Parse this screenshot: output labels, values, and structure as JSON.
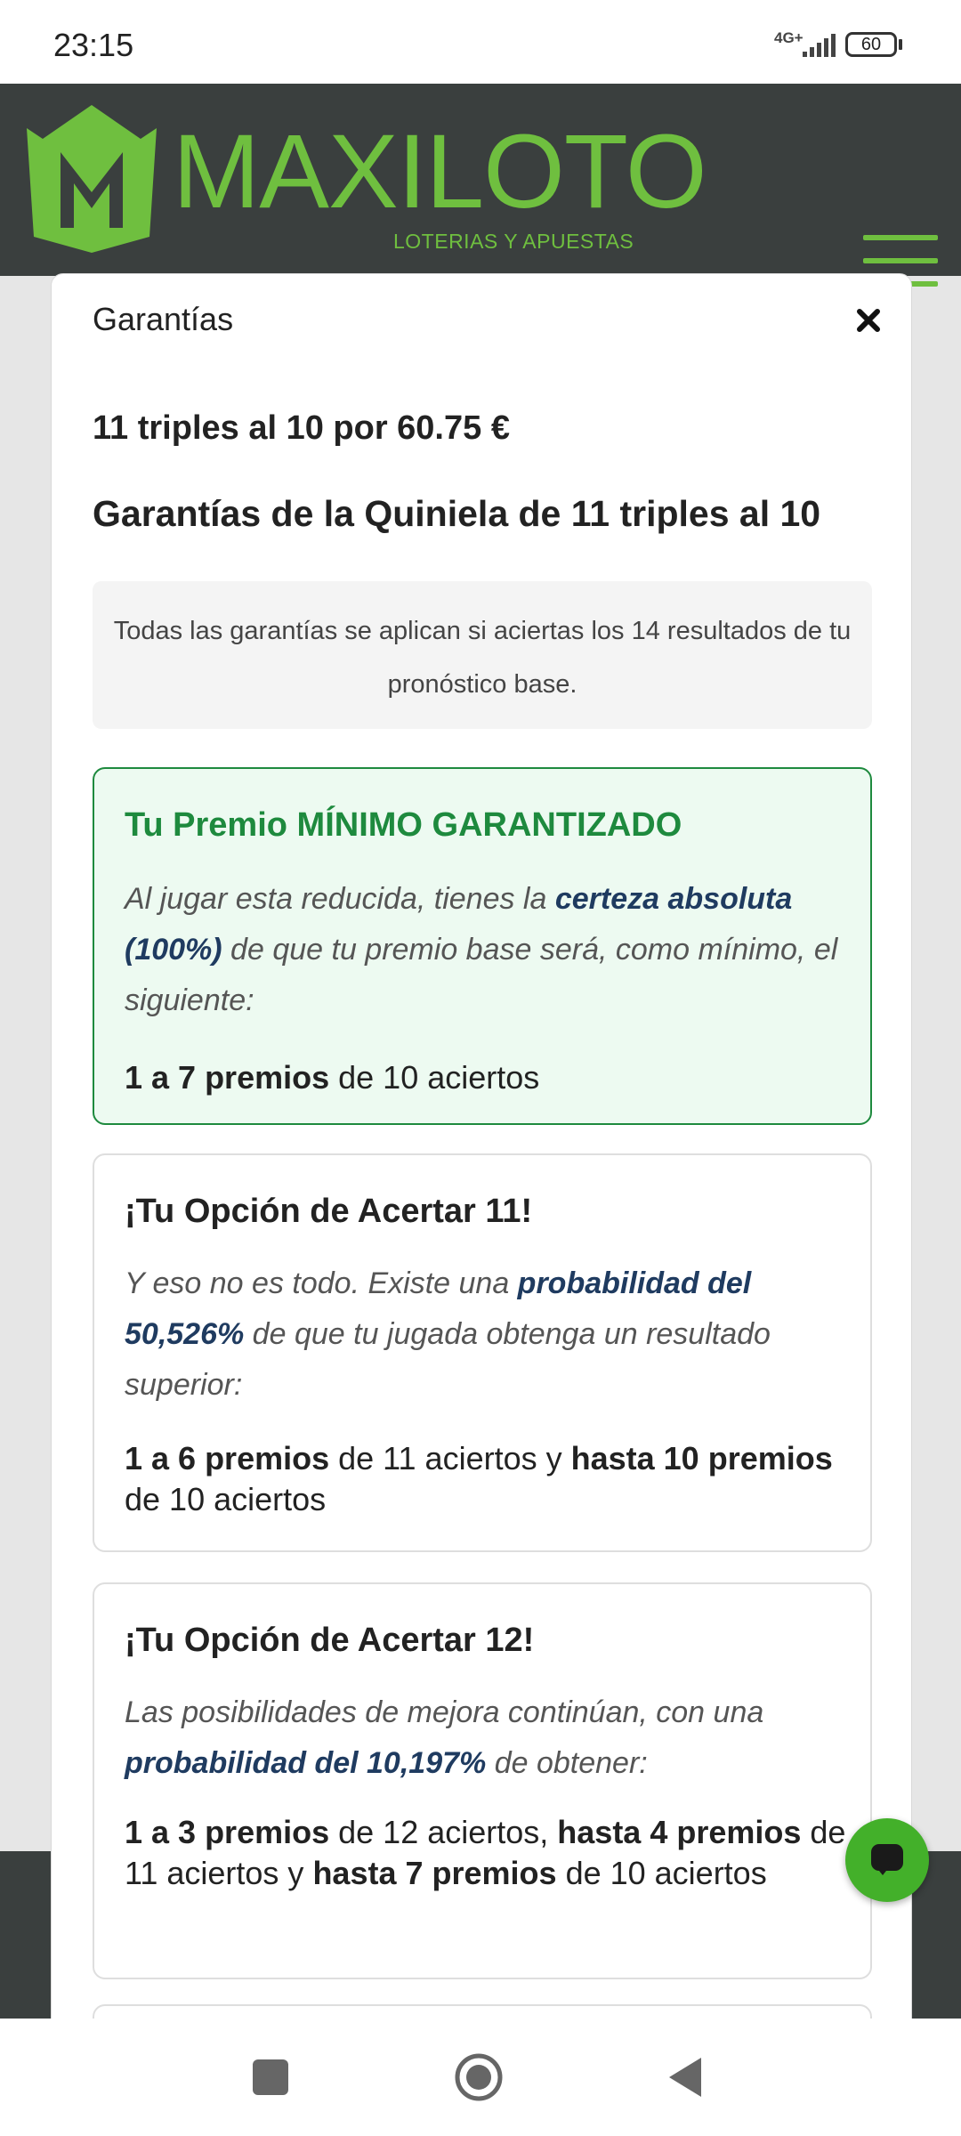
{
  "status_bar": {
    "time": "23:15",
    "network": "4G+",
    "battery": "60"
  },
  "header": {
    "brand": "MAXILOTO",
    "tagline": "LOTERIAS Y APUESTAS",
    "brand_color": "#6fbf3f",
    "background_color": "#3a3f3e",
    "menu_icon": "hamburger-menu-icon"
  },
  "modal": {
    "title": "Garantías",
    "close_icon": "close-icon",
    "summary": "11 triples al 10 por 60.75 €",
    "heading": "Garantías de la Quiniela de 11 triples al 10",
    "info": "Todas las garantías se aplican si aciertas los 14 resultados de tu pronóstico base."
  },
  "cards": [
    {
      "title": "Tu Premio MÍNIMO GARANTIZADO",
      "desc_1": "Al jugar esta reducida, tienes la ",
      "desc_bold": "certeza absoluta (100%)",
      "desc_2": " de que tu premio base será, como mínimo, el siguiente:",
      "result_b1": "1 a 7 premios",
      "result_t1": " de 10 aciertos"
    },
    {
      "title": "¡Tu Opción de Acertar 11!",
      "desc_1": "Y eso no es todo. Existe una ",
      "desc_bold": "probabilidad del 50,526%",
      "desc_2": " de que tu jugada obtenga un resultado superior:",
      "result_b1": "1 a 6 premios",
      "result_t1": " de 11 aciertos y ",
      "result_b2": "hasta 10 premios",
      "result_t2": " de 10 aciertos"
    },
    {
      "title": "¡Tu Opción de Acertar 12!",
      "desc_1": "Las posibilidades de mejora continúan, con una ",
      "desc_bold": "probabilidad del 10,197%",
      "desc_2": " de obtener:",
      "result_b1": "1 a 3 premios",
      "result_t1": " de 12 aciertos, ",
      "result_b2": "hasta 4 premios",
      "result_t2": " de 11 aciertos y ",
      "result_b3": "hasta 7 premios",
      "result_t3": " de 10 aciertos"
    }
  ],
  "chat_button": {
    "icon": "chat-bubble-icon",
    "color": "#43b02a"
  },
  "nav": {
    "recent_icon": "recent-apps-icon",
    "home_icon": "home-icon",
    "back_icon": "back-icon"
  }
}
